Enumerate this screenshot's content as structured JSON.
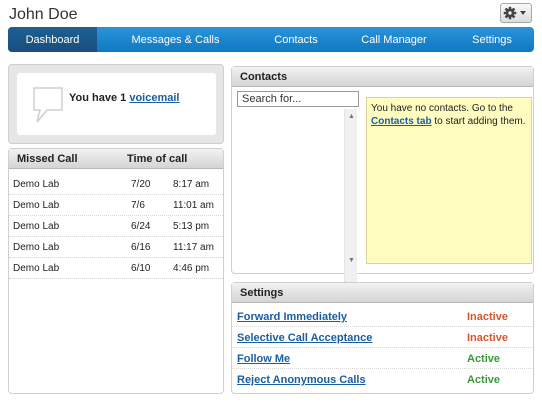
{
  "user": {
    "name": "John Doe"
  },
  "nav": {
    "tabs": [
      {
        "label": "Dashboard"
      },
      {
        "label": "Messages & Calls"
      },
      {
        "label": "Contacts"
      },
      {
        "label": "Call Manager"
      },
      {
        "label": "Settings"
      }
    ],
    "active": "Dashboard"
  },
  "voicemail": {
    "prefix": "You have 1 ",
    "link": "voicemail"
  },
  "missed_calls": {
    "headers": {
      "caller": "Missed Call",
      "time": "Time of call"
    },
    "rows": [
      {
        "caller": "Demo Lab",
        "date": "7/20",
        "time": "8:17 am"
      },
      {
        "caller": "Demo Lab",
        "date": "7/6",
        "time": "11:01 am"
      },
      {
        "caller": "Demo Lab",
        "date": "6/24",
        "time": "5:13 pm"
      },
      {
        "caller": "Demo Lab",
        "date": "6/16",
        "time": "11:17 am"
      },
      {
        "caller": "Demo Lab",
        "date": "6/10",
        "time": "4:46 pm"
      }
    ]
  },
  "contacts": {
    "title": "Contacts",
    "search_placeholder": "Search for...",
    "empty_prefix": "You have no contacts. Go to the ",
    "empty_link": "Contacts tab",
    "empty_suffix": " to start adding them."
  },
  "settings": {
    "title": "Settings",
    "rows": [
      {
        "name": "Forward Immediately",
        "status": "Inactive"
      },
      {
        "name": "Selective Call Acceptance",
        "status": "Inactive"
      },
      {
        "name": "Follow Me",
        "status": "Active"
      },
      {
        "name": "Reject Anonymous Calls",
        "status": "Active"
      }
    ]
  },
  "colors": {
    "nav": "#1a86cf",
    "nav_active": "#1a5787",
    "link": "#1a5ea0",
    "inactive": "#d4572b",
    "active": "#3a9a3a",
    "note_bg": "#fffcc0"
  },
  "icons": {
    "settings_menu": "gear-icon",
    "dropdown": "caret-down-icon",
    "voicemail": "speech-bubble-icon"
  }
}
